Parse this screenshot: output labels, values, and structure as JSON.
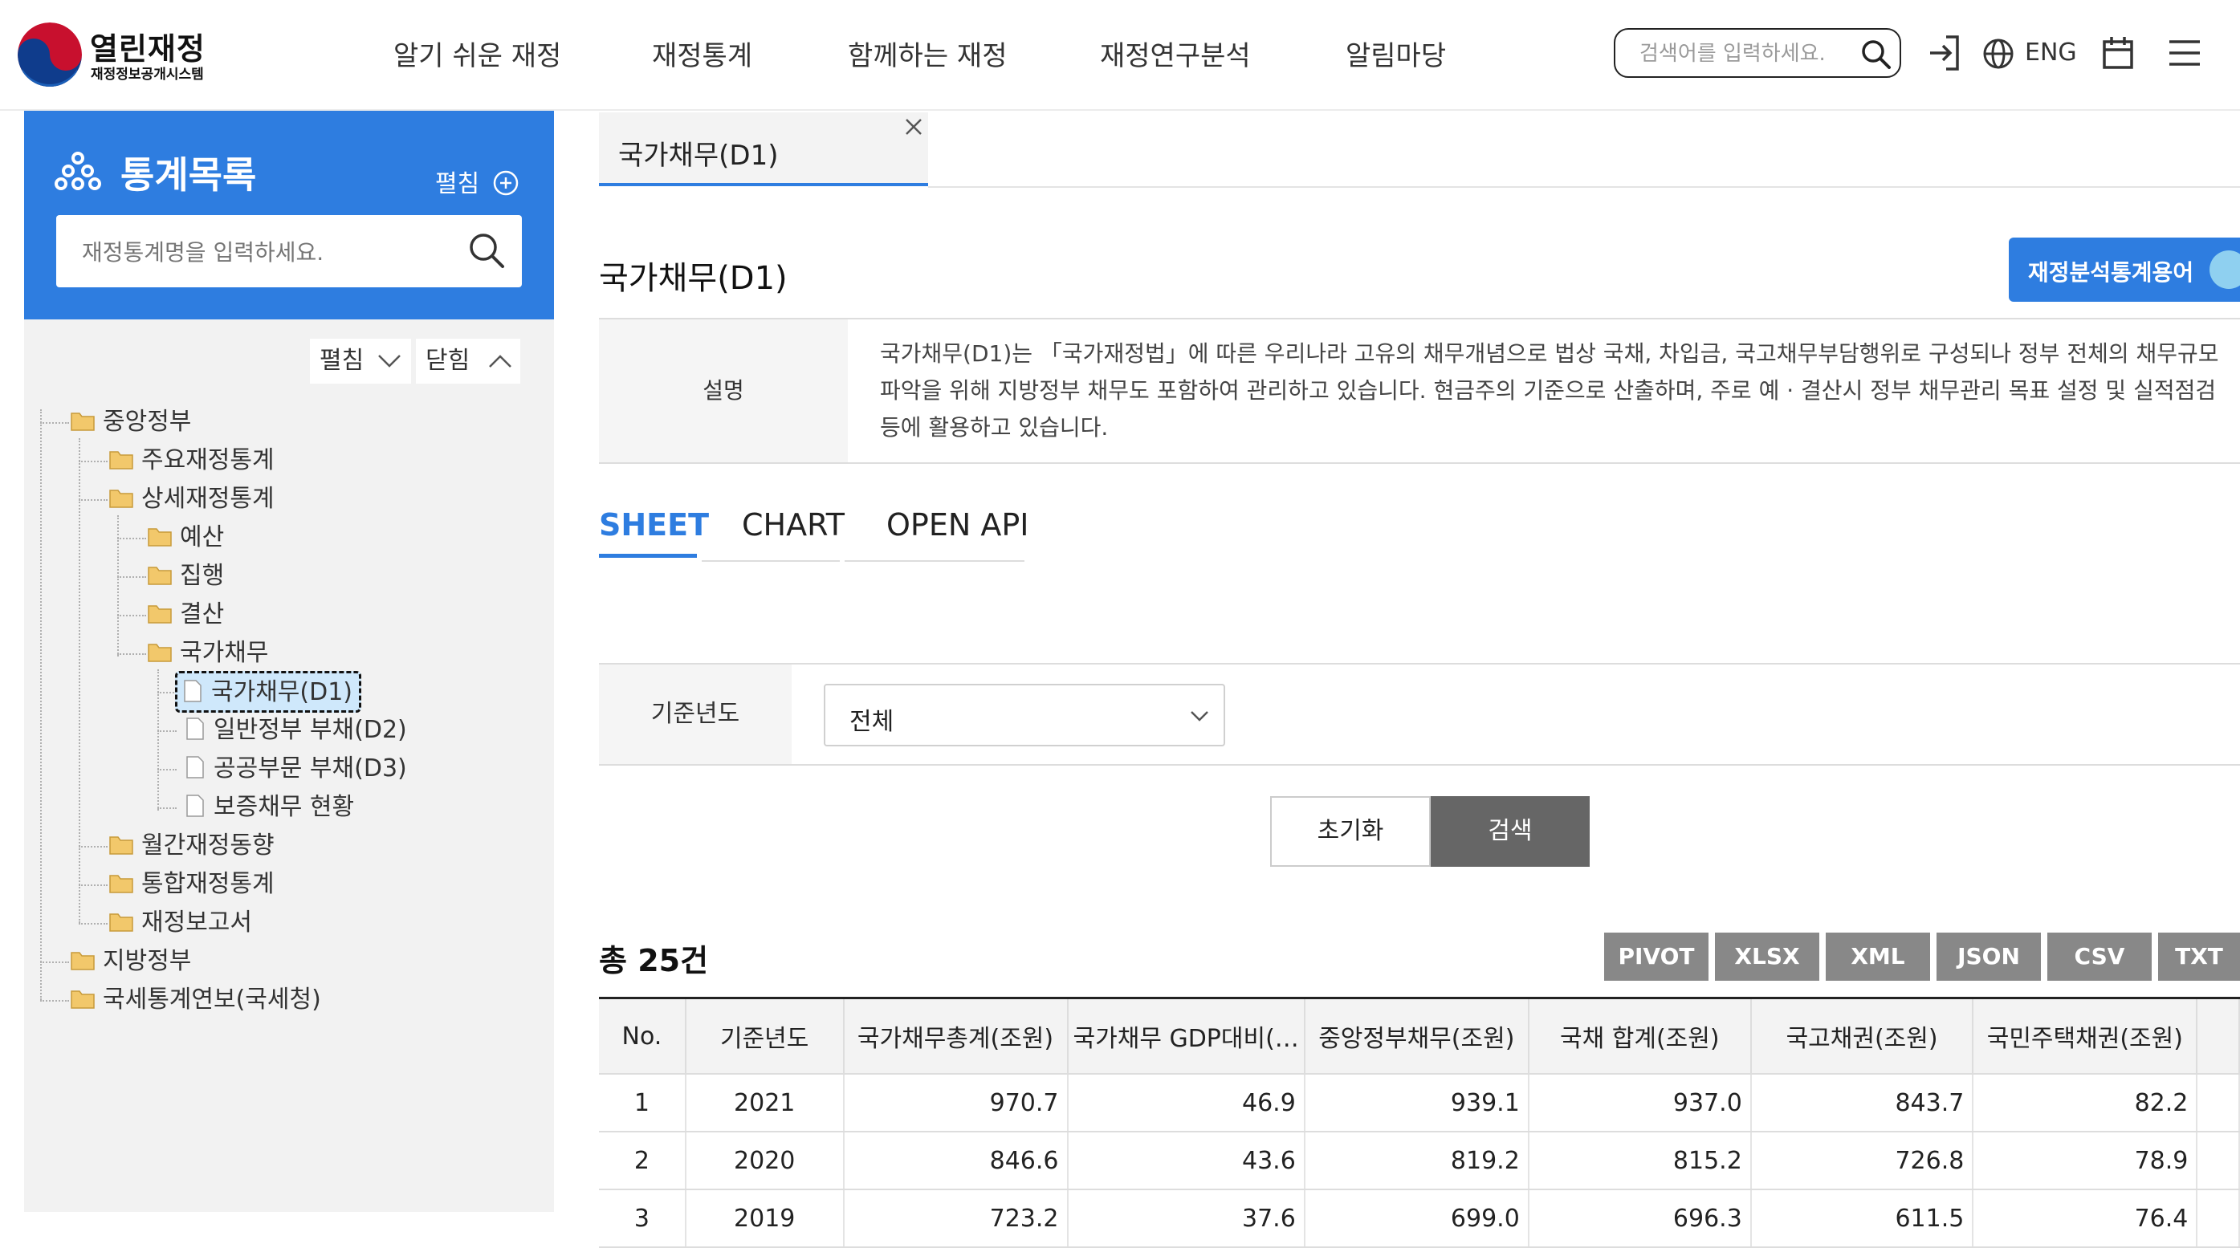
{
  "header": {
    "logo_title": "열린재정",
    "logo_subtitle": "재정정보공개시스템",
    "nav": [
      "알기 쉬운 재정",
      "재정통계",
      "함께하는 재정",
      "재정연구분석",
      "알림마당"
    ],
    "search_placeholder": "검색어를 입력하세요.",
    "lang_label": "ENG"
  },
  "sidebar": {
    "title": "통계목록",
    "expand_label": "펼침",
    "search_placeholder": "재정통계명을 입력하세요.",
    "tree_expand": "펼침",
    "tree_collapse": "닫힘",
    "tree": [
      {
        "label": "중앙정부",
        "type": "folder"
      },
      {
        "label": "주요재정통계",
        "type": "folder"
      },
      {
        "label": "상세재정통계",
        "type": "folder"
      },
      {
        "label": "예산",
        "type": "folder"
      },
      {
        "label": "집행",
        "type": "folder"
      },
      {
        "label": "결산",
        "type": "folder"
      },
      {
        "label": "국가채무",
        "type": "folder"
      },
      {
        "label": "국가채무(D1)",
        "type": "doc",
        "selected": true
      },
      {
        "label": "일반정부 부채(D2)",
        "type": "doc"
      },
      {
        "label": "공공부문 부채(D3)",
        "type": "doc"
      },
      {
        "label": "보증채무 현황",
        "type": "doc"
      },
      {
        "label": "월간재정동향",
        "type": "folder"
      },
      {
        "label": "통합재정통계",
        "type": "folder"
      },
      {
        "label": "재정보고서",
        "type": "folder"
      },
      {
        "label": "지방정부",
        "type": "folder"
      },
      {
        "label": "국세통계연보(국세청)",
        "type": "folder"
      }
    ]
  },
  "main": {
    "tab_label": "국가채무(D1)",
    "page_title": "국가채무(D1)",
    "term_button": "재정분석통계용어",
    "desc_label": "설명",
    "desc_text": "국가채무(D1)는 「국가재정법」에 따른 우리나라 고유의 채무개념으로 법상 국채, 차입금, 국고채무부담행위로 구성되나 정부 전체의 채무규모 파악을 위해 지방정부 채무도 포함하여 관리하고 있습니다. 현금주의 기준으로 산출하며, 주로 예 · 결산시 정부 채무관리 목표 설정 및 실적점검 등에 활용하고 있습니다.",
    "sub_tabs": [
      "SHEET",
      "CHART",
      "OPEN API"
    ],
    "filter_label": "기준년도",
    "filter_value": "전체",
    "reset_label": "초기화",
    "search_label": "검색",
    "total_label": "총 25건",
    "download_buttons": [
      "PIVOT",
      "XLSX",
      "XML",
      "JSON",
      "CSV",
      "TXT"
    ]
  },
  "table": {
    "headers": [
      "No.",
      "기준년도",
      "국가채무총계(조원)",
      "국가채무 GDP대비(…",
      "중앙정부채무(조원)",
      "국채 합계(조원)",
      "국고채권(조원)",
      "국민주택채권(조원)"
    ],
    "rows": [
      [
        "1",
        "2021",
        "970.7",
        "46.9",
        "939.1",
        "937.0",
        "843.7",
        "82.2"
      ],
      [
        "2",
        "2020",
        "846.6",
        "43.6",
        "819.2",
        "815.2",
        "726.8",
        "78.9"
      ],
      [
        "3",
        "2019",
        "723.2",
        "37.6",
        "699.0",
        "696.3",
        "611.5",
        "76.4"
      ]
    ]
  }
}
